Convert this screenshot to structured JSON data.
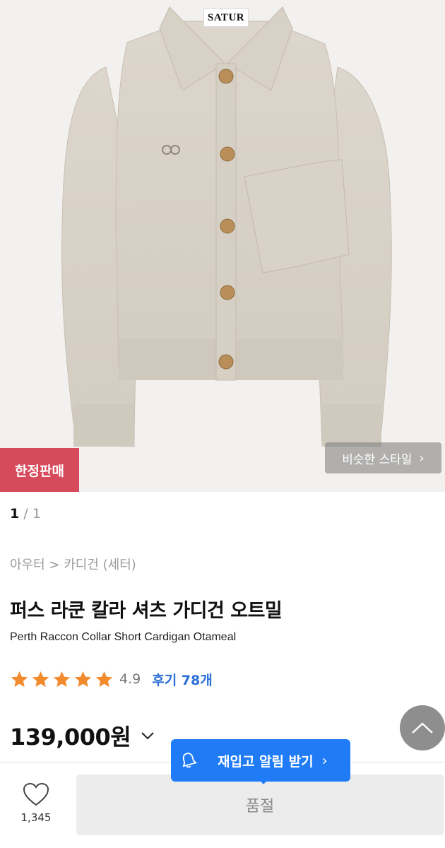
{
  "hero": {
    "image_alt": "product-image",
    "brand_tag": "SATUR",
    "limited_badge": "한정판매",
    "similar_style_label": "비슷한 스타일",
    "similar_style_icon": "chevron-right-icon"
  },
  "pager": {
    "current": "1",
    "separator": " / ",
    "total": "1"
  },
  "breadcrumb": "아우터 > 카디건 (세터)",
  "product": {
    "title_ko": "퍼스 라쿤 칼라 셔츠 가디건 오트밀",
    "title_en": "Perth Raccon Collar Short Cardigan Otameal",
    "rating_stars": 5,
    "rating_score": "4.9",
    "reviews_label": "후기 78개",
    "price": "139,000원"
  },
  "colors": {
    "star": "#f28a2e",
    "accent_blue": "#1f7cf6",
    "limited_red": "#d64a5b"
  },
  "bottom_bar": {
    "wish_count": "1,345",
    "soldout_label": "품절",
    "restock_label": "재입고 알림 받기"
  }
}
